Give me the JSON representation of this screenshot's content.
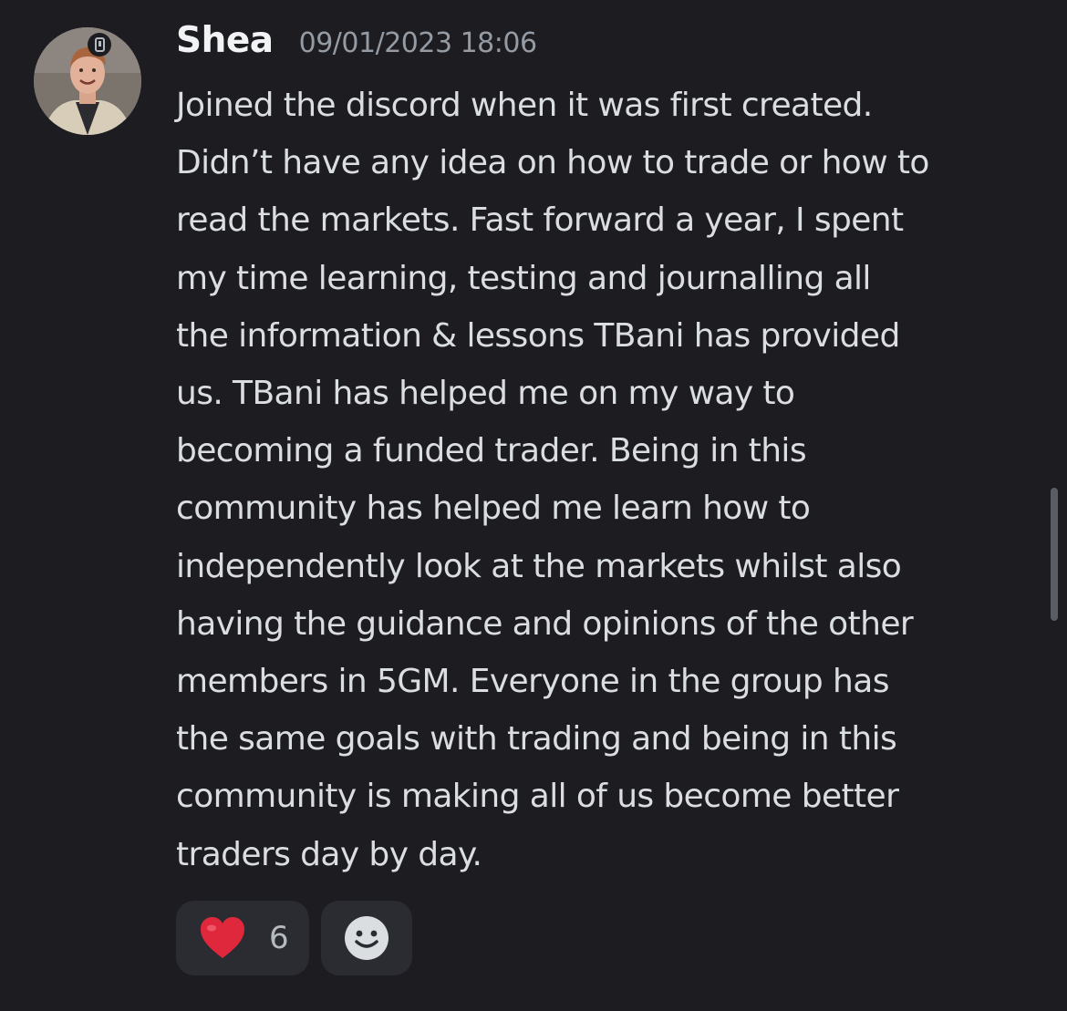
{
  "message": {
    "author": "Shea",
    "timestamp": "09/01/2023 18:06",
    "lines": [
      "Joined the discord when it was first created.",
      "Didn’t have any idea on how to trade or how to",
      "read the markets. Fast forward a year, I spent",
      "my time learning, testing and journalling all",
      "the information & lessons TBani has provided",
      "us. TBani has helped me on my way to",
      "becoming a funded trader. Being in this",
      "community has helped me learn how to",
      "independently look at the markets whilst also",
      "having the guidance and opinions of the other",
      "members in 5GM. Everyone in the group has",
      "the same goals with trading and being in this",
      "community is making all of us become better",
      "traders day by day."
    ]
  },
  "reactions": [
    {
      "emoji": "heart-emoji",
      "count": "6"
    }
  ],
  "icons": {
    "add_reaction": "smiley-icon",
    "mobile_status": "mobile-phone-icon"
  },
  "colors": {
    "background": "#1c1c21",
    "reaction_bg": "#2b2c32",
    "heart": "#e0283c"
  }
}
